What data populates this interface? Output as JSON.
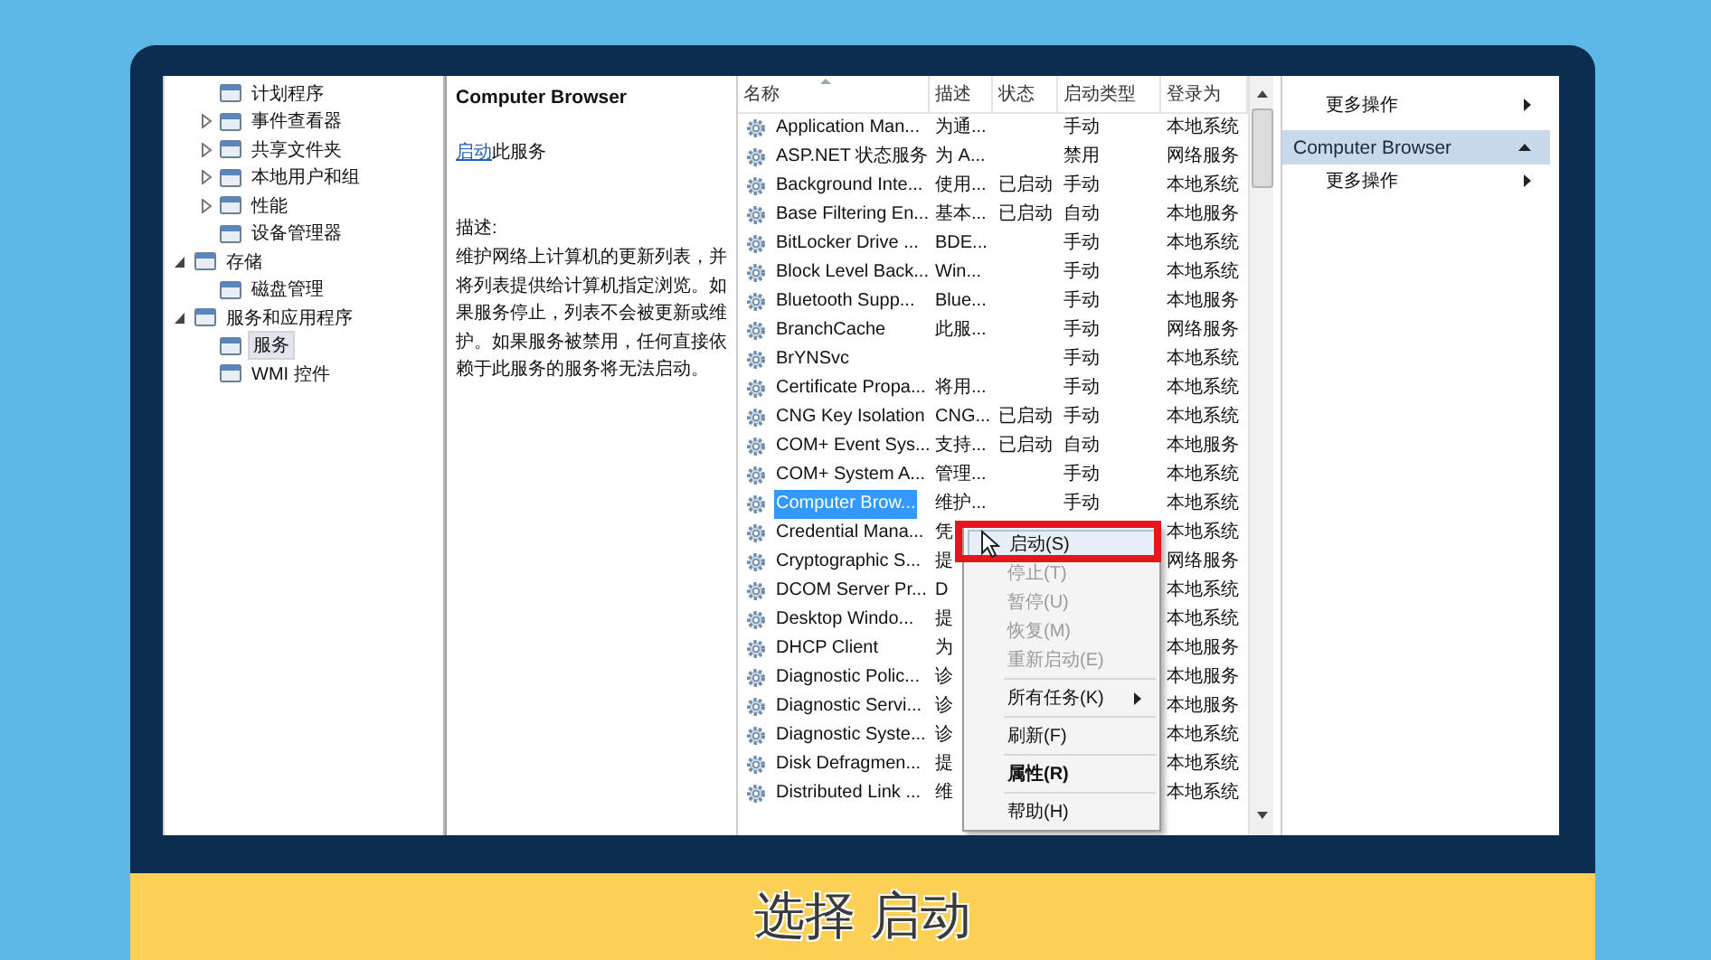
{
  "tree": [
    {
      "children": [
        {
          "label": "计划程序"
        },
        {
          "label": "事件查看器",
          "expanded": false
        },
        {
          "label": "共享文件夹",
          "expanded": false
        },
        {
          "label": "本地用户和组",
          "expanded": false
        },
        {
          "label": "性能",
          "expanded": false
        },
        {
          "label": "设备管理器"
        }
      ]
    },
    {
      "label": "存储",
      "expanded": true,
      "children": [
        {
          "label": "磁盘管理"
        }
      ]
    },
    {
      "label": "服务和应用程序",
      "expanded": true,
      "children": [
        {
          "label": "服务",
          "selected": true
        },
        {
          "label": "WMI 控件",
          "selected": false
        }
      ]
    }
  ],
  "detail": {
    "title": "Computer Browser",
    "action_link": "启动",
    "action_rest": "此服务",
    "description_label": "描述:",
    "description": "维护网络上计算机的更新列表，并将列表提供给计算机指定浏览。如果服务停止，列表不会被更新或维护。如果服务被禁用，任何直接依赖于此服务的服务将无法启动。"
  },
  "services": {
    "columns": [
      "名称",
      "描述",
      "状态",
      "启动类型",
      "登录为"
    ],
    "rows": [
      {
        "name": "Application Man...",
        "description": "为通...",
        "startup": "手动",
        "logon": "本地系统",
        "selected": false
      },
      {
        "name": "ASP.NET 状态服务",
        "description": "为 A...",
        "startup": "禁用",
        "logon": "网络服务",
        "selected": false
      },
      {
        "name": "Background Inte...",
        "description": "使用...",
        "status": "已启动",
        "startup": "手动",
        "logon": "本地系统",
        "selected": false
      },
      {
        "name": "Base Filtering En...",
        "description": "基本...",
        "status": "已启动",
        "startup": "自动",
        "logon": "本地服务",
        "selected": false
      },
      {
        "name": "BitLocker Drive ...",
        "description": "BDE...",
        "startup": "手动",
        "logon": "本地系统",
        "selected": false
      },
      {
        "name": "Block Level Back...",
        "description": "Win...",
        "startup": "手动",
        "logon": "本地系统",
        "selected": false
      },
      {
        "name": "Bluetooth Supp...",
        "description": "Blue...",
        "startup": "手动",
        "logon": "本地服务",
        "selected": false
      },
      {
        "name": "BranchCache",
        "description": "此服...",
        "startup": "手动",
        "logon": "网络服务",
        "selected": false
      },
      {
        "name": "BrYNSvc",
        "startup": "手动",
        "logon": "本地系统",
        "selected": false
      },
      {
        "name": "Certificate Propa...",
        "description": "将用...",
        "startup": "手动",
        "logon": "本地系统",
        "selected": false
      },
      {
        "name": "CNG Key Isolation",
        "description": "CNG...",
        "status": "已启动",
        "startup": "手动",
        "logon": "本地系统",
        "selected": false
      },
      {
        "name": "COM+ Event Sys...",
        "description": "支持...",
        "status": "已启动",
        "startup": "自动",
        "logon": "本地服务",
        "selected": false
      },
      {
        "name": "COM+ System A...",
        "description": "管理...",
        "startup": "手动",
        "logon": "本地系统",
        "selected": false
      },
      {
        "name": "Computer Brow...",
        "description": "维护...",
        "startup": "手动",
        "logon": "本地系统",
        "selected": true
      },
      {
        "name": "Credential Mana...",
        "description": "凭",
        "logon": "本地系统",
        "selected": false
      },
      {
        "name": "Cryptographic S...",
        "description": "提",
        "logon": "网络服务",
        "selected": false
      },
      {
        "name": "DCOM Server Pr...",
        "description": "D",
        "logon": "本地系统",
        "selected": false
      },
      {
        "name": "Desktop Windo...",
        "description": "提",
        "logon": "本地系统",
        "selected": false
      },
      {
        "name": "DHCP Client",
        "description": "为",
        "logon": "本地服务",
        "selected": false
      },
      {
        "name": "Diagnostic Polic...",
        "description": "诊",
        "logon": "本地服务",
        "selected": false
      },
      {
        "name": "Diagnostic Servi...",
        "description": "诊",
        "logon": "本地服务",
        "selected": false
      },
      {
        "name": "Diagnostic Syste...",
        "description": "诊",
        "logon": "本地系统",
        "selected": false
      },
      {
        "name": "Disk Defragmen...",
        "description": "提",
        "logon": "本地系统",
        "selected": false
      },
      {
        "name": "Distributed Link ...",
        "description": "维",
        "logon": "本地系统",
        "selected": false
      }
    ]
  },
  "context_menu": [
    {
      "kind": "item",
      "label": "启动(S)",
      "selected": true,
      "disabled": false
    },
    {
      "kind": "item",
      "label": "停止(T)",
      "selected": false,
      "disabled": true
    },
    {
      "kind": "item",
      "label": "暂停(U)",
      "selected": false,
      "disabled": true
    },
    {
      "kind": "item",
      "label": "恢复(M)",
      "selected": false,
      "disabled": true
    },
    {
      "kind": "item",
      "label": "重新启动(E)",
      "selected": false,
      "disabled": true
    },
    {
      "kind": "separator"
    },
    {
      "kind": "submenu",
      "label": "所有任务(K)",
      "selected": false,
      "disabled": false
    },
    {
      "kind": "separator"
    },
    {
      "kind": "item",
      "label": "刷新(F)",
      "selected": false,
      "disabled": false
    },
    {
      "kind": "separator"
    },
    {
      "kind": "item",
      "label": "属性(R)",
      "selected": false,
      "disabled": false,
      "bold": true
    },
    {
      "kind": "separator"
    },
    {
      "kind": "item",
      "label": "帮助(H)",
      "selected": false,
      "disabled": false
    }
  ],
  "actions": [
    {
      "kind": "link",
      "label": "更多操作"
    },
    {
      "kind": "header",
      "label": "Computer Browser"
    },
    {
      "kind": "link",
      "label": "更多操作"
    }
  ],
  "caption": "选择 启动"
}
